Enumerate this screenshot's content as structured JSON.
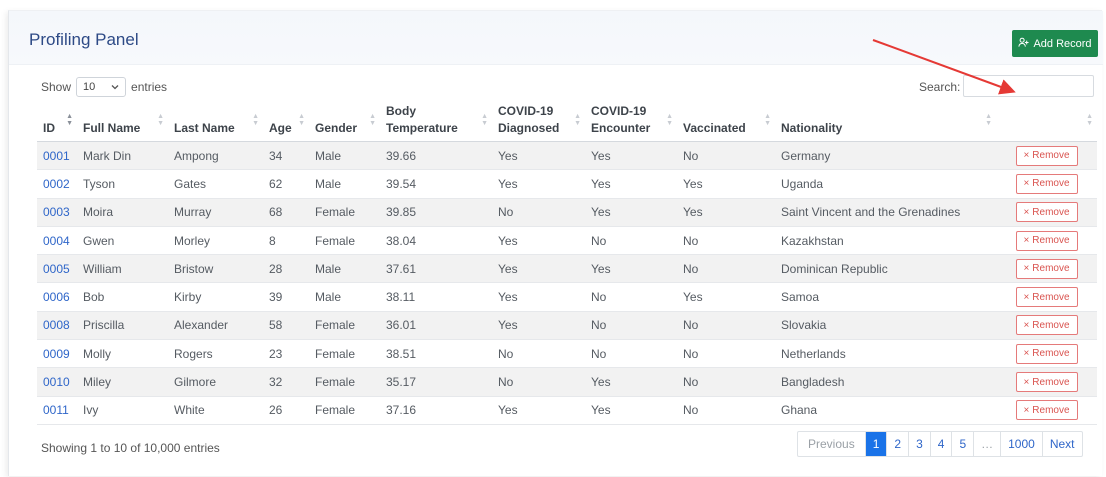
{
  "panel": {
    "title": "Profiling Panel",
    "add_label": "Add Record"
  },
  "length": {
    "show": "Show",
    "value": "10",
    "entries": "entries"
  },
  "search": {
    "label": "Search:",
    "value": ""
  },
  "columns": [
    "ID",
    "Full Name",
    "Last Name",
    "Age",
    "Gender",
    "Body Temperature",
    "COVID-19 Diagnosed",
    "COVID-19 Encounter",
    "Vaccinated",
    "Nationality",
    ""
  ],
  "rows": [
    {
      "id": "0001",
      "first": "Mark Din",
      "last": "Ampong",
      "age": "34",
      "gender": "Male",
      "temp": "39.66",
      "diag": "Yes",
      "enc": "Yes",
      "vacc": "No",
      "nat": "Germany"
    },
    {
      "id": "0002",
      "first": "Tyson",
      "last": "Gates",
      "age": "62",
      "gender": "Male",
      "temp": "39.54",
      "diag": "Yes",
      "enc": "Yes",
      "vacc": "Yes",
      "nat": "Uganda"
    },
    {
      "id": "0003",
      "first": "Moira",
      "last": "Murray",
      "age": "68",
      "gender": "Female",
      "temp": "39.85",
      "diag": "No",
      "enc": "Yes",
      "vacc": "Yes",
      "nat": "Saint Vincent and the Grenadines"
    },
    {
      "id": "0004",
      "first": "Gwen",
      "last": "Morley",
      "age": "8",
      "gender": "Female",
      "temp": "38.04",
      "diag": "Yes",
      "enc": "No",
      "vacc": "No",
      "nat": "Kazakhstan"
    },
    {
      "id": "0005",
      "first": "William",
      "last": "Bristow",
      "age": "28",
      "gender": "Male",
      "temp": "37.61",
      "diag": "Yes",
      "enc": "Yes",
      "vacc": "No",
      "nat": "Dominican Republic"
    },
    {
      "id": "0006",
      "first": "Bob",
      "last": "Kirby",
      "age": "39",
      "gender": "Male",
      "temp": "38.11",
      "diag": "Yes",
      "enc": "No",
      "vacc": "Yes",
      "nat": "Samoa"
    },
    {
      "id": "0008",
      "first": "Priscilla",
      "last": "Alexander",
      "age": "58",
      "gender": "Female",
      "temp": "36.01",
      "diag": "Yes",
      "enc": "No",
      "vacc": "No",
      "nat": "Slovakia"
    },
    {
      "id": "0009",
      "first": "Molly",
      "last": "Rogers",
      "age": "23",
      "gender": "Female",
      "temp": "38.51",
      "diag": "No",
      "enc": "No",
      "vacc": "No",
      "nat": "Netherlands"
    },
    {
      "id": "0010",
      "first": "Miley",
      "last": "Gilmore",
      "age": "32",
      "gender": "Female",
      "temp": "35.17",
      "diag": "No",
      "enc": "Yes",
      "vacc": "No",
      "nat": "Bangladesh"
    },
    {
      "id": "0011",
      "first": "Ivy",
      "last": "White",
      "age": "26",
      "gender": "Female",
      "temp": "37.16",
      "diag": "Yes",
      "enc": "Yes",
      "vacc": "No",
      "nat": "Ghana"
    }
  ],
  "remove_label": "Remove",
  "info": "Showing 1 to 10 of 10,000 entries",
  "pagination": {
    "previous": "Previous",
    "pages": [
      "1",
      "2",
      "3",
      "4",
      "5",
      "…",
      "1000"
    ],
    "active": "1",
    "next": "Next"
  },
  "colors": {
    "accent": "#1a73e8",
    "add_button": "#1e8a4f",
    "remove": "#d9534f",
    "arrow": "#e53935",
    "title": "#2d4a86"
  },
  "icons": {
    "add": "add-user-icon",
    "remove": "close-icon",
    "length": "chevron-down-icon"
  }
}
